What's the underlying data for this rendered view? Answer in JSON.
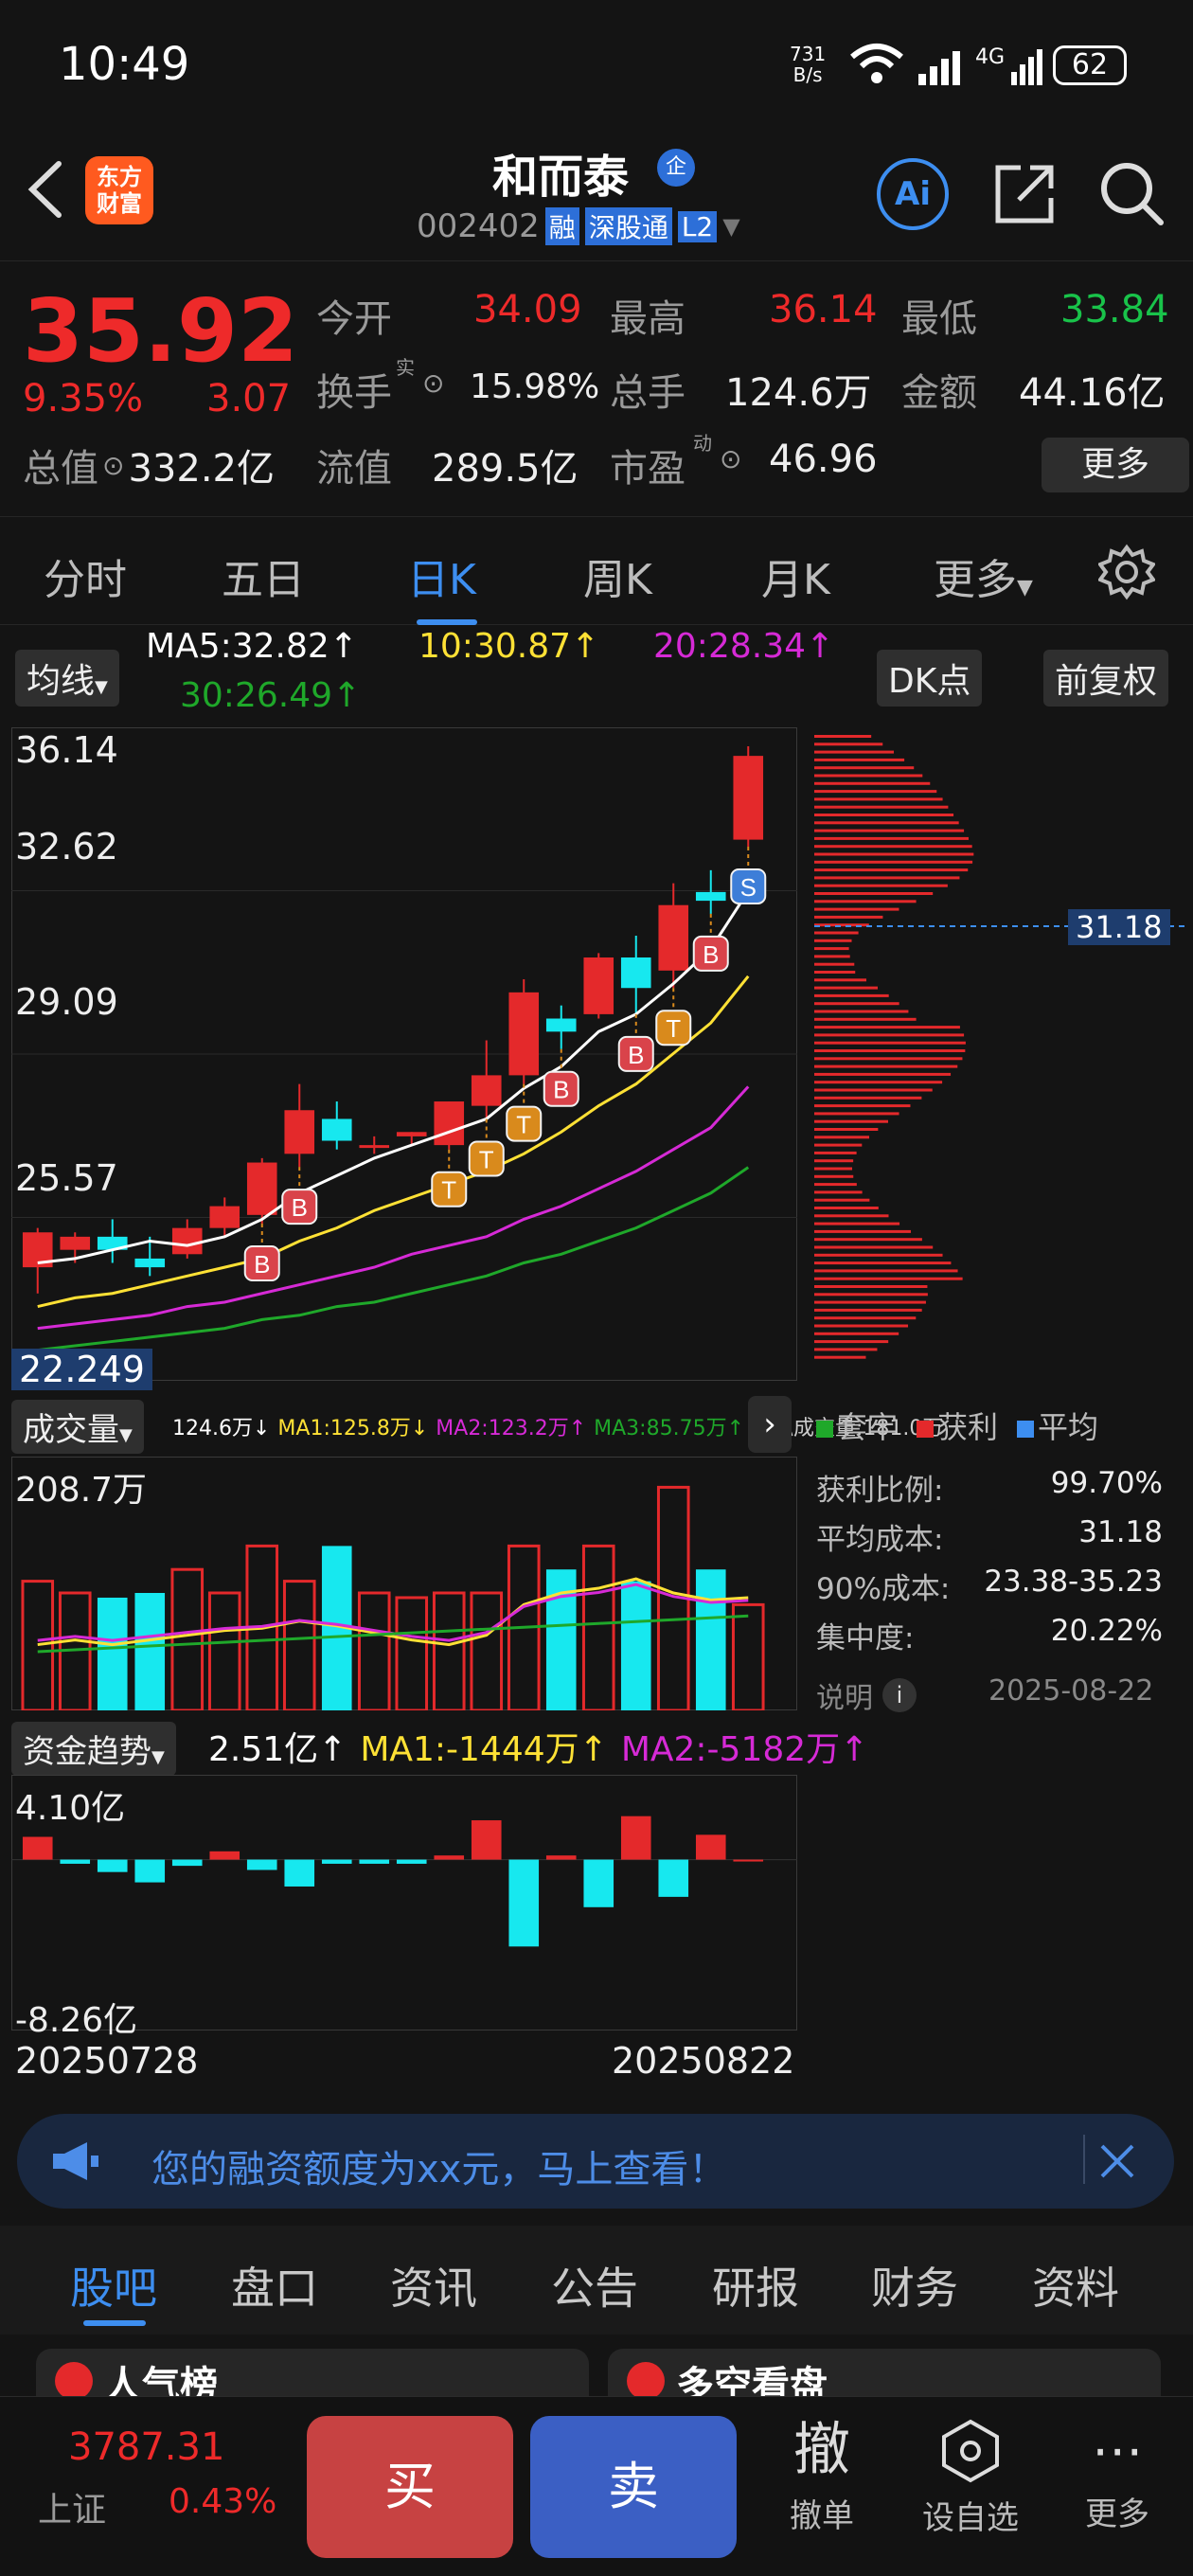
{
  "status": {
    "time": "10:49",
    "net_speed_top": "731",
    "net_speed_bottom": "B/s",
    "signal": "4G",
    "battery": "62"
  },
  "header": {
    "app_logo_line1": "东方",
    "app_logo_line2": "财富",
    "stock_name": "和而泰",
    "name_badge": "企",
    "code": "002402",
    "tag_margin": "融",
    "tag_connect": "深股通",
    "tag_level": "L2",
    "ai_label": "Ai"
  },
  "quote": {
    "price": "35.92",
    "change_pct": "9.35%",
    "change": "3.07",
    "open_label": "今开",
    "open": "34.09",
    "high_label": "最高",
    "high": "36.14",
    "low_label": "最低",
    "low": "33.84",
    "turnover_label": "换手",
    "turnover_sup": "实",
    "turnover": "15.98%",
    "volume_label": "总手",
    "volume": "124.6万",
    "amount_label": "金额",
    "amount": "44.16亿",
    "mktcap_label": "总值",
    "mktcap": "332.2亿",
    "float_label": "流值",
    "float": "289.5亿",
    "pe_label": "市盈",
    "pe_sup": "动",
    "pe": "46.96",
    "more": "更多"
  },
  "tabs": [
    "分时",
    "五日",
    "日K",
    "周K",
    "月K",
    "更多"
  ],
  "kline": {
    "ma_button": "均线",
    "ma5": "MA5:32.82↑",
    "ma10": "10:30.87↑",
    "ma20": "20:28.34↑",
    "ma30": "30:26.49↑",
    "dk_button": "DK点",
    "adjust_button": "前复权",
    "y_labels": [
      "36.14",
      "32.62",
      "29.09",
      "25.57"
    ],
    "low_label": "22.249",
    "profile_price": "31.18",
    "colors": {
      "up": "#e4292b",
      "down": "#17e8ef",
      "ma5": "#ffffff",
      "ma10": "#ffe135",
      "ma20": "#d62ad6",
      "ma30": "#1fa82a"
    }
  },
  "chart_data": {
    "type": "candlestick",
    "x_start": "20250728",
    "x_end": "20250822",
    "ylim": [
      22.249,
      36.14
    ],
    "candles": [
      {
        "o": 24.2,
        "h": 25.1,
        "l": 23.6,
        "c": 25.0
      },
      {
        "o": 24.6,
        "h": 25.0,
        "l": 24.3,
        "c": 24.9
      },
      {
        "o": 24.9,
        "h": 25.3,
        "l": 24.3,
        "c": 24.6
      },
      {
        "o": 24.4,
        "h": 24.9,
        "l": 24.0,
        "c": 24.2
      },
      {
        "o": 24.5,
        "h": 25.3,
        "l": 24.4,
        "c": 25.1
      },
      {
        "o": 25.1,
        "h": 25.8,
        "l": 24.9,
        "c": 25.6
      },
      {
        "o": 25.4,
        "h": 26.7,
        "l": 25.2,
        "c": 26.6
      },
      {
        "o": 26.8,
        "h": 28.4,
        "l": 26.5,
        "c": 27.8
      },
      {
        "o": 27.6,
        "h": 28.0,
        "l": 26.9,
        "c": 27.1
      },
      {
        "o": 27.0,
        "h": 27.2,
        "l": 26.8,
        "c": 27.0
      },
      {
        "o": 27.2,
        "h": 27.3,
        "l": 27.0,
        "c": 27.3
      },
      {
        "o": 27.0,
        "h": 28.0,
        "l": 26.9,
        "c": 28.0
      },
      {
        "o": 27.9,
        "h": 29.4,
        "l": 27.6,
        "c": 28.6
      },
      {
        "o": 28.6,
        "h": 30.8,
        "l": 28.4,
        "c": 30.5
      },
      {
        "o": 29.9,
        "h": 30.2,
        "l": 29.2,
        "c": 29.6
      },
      {
        "o": 30.0,
        "h": 31.4,
        "l": 29.9,
        "c": 31.3
      },
      {
        "o": 31.3,
        "h": 31.8,
        "l": 30.0,
        "c": 30.6
      },
      {
        "o": 31.0,
        "h": 33.0,
        "l": 30.6,
        "c": 32.5
      },
      {
        "o": 32.8,
        "h": 33.3,
        "l": 32.3,
        "c": 32.6
      },
      {
        "o": 34.0,
        "h": 36.14,
        "l": 33.84,
        "c": 35.92
      }
    ],
    "ma5": [
      24.3,
      24.4,
      24.6,
      24.8,
      24.7,
      24.9,
      25.3,
      25.9,
      26.3,
      26.7,
      27.0,
      27.3,
      27.6,
      28.3,
      28.8,
      29.6,
      30.0,
      30.7,
      31.5,
      32.82
    ],
    "ma10": [
      23.3,
      23.5,
      23.6,
      23.8,
      24.0,
      24.2,
      24.4,
      24.8,
      25.1,
      25.5,
      25.8,
      26.1,
      26.4,
      26.8,
      27.3,
      27.9,
      28.4,
      29.1,
      29.8,
      30.87
    ],
    "ma20": [
      22.8,
      22.9,
      23.0,
      23.1,
      23.3,
      23.4,
      23.6,
      23.8,
      24.0,
      24.2,
      24.5,
      24.7,
      24.9,
      25.3,
      25.6,
      26.0,
      26.4,
      26.9,
      27.4,
      28.34
    ],
    "ma30": [
      22.3,
      22.4,
      22.5,
      22.6,
      22.7,
      22.8,
      23.0,
      23.1,
      23.3,
      23.4,
      23.6,
      23.8,
      24.0,
      24.3,
      24.5,
      24.8,
      25.1,
      25.5,
      25.9,
      26.49
    ],
    "signals": [
      {
        "i": 6,
        "label": "B",
        "below": true
      },
      {
        "i": 7,
        "label": "B",
        "below": true
      },
      {
        "i": 11,
        "label": "T",
        "below": true
      },
      {
        "i": 12,
        "label": "T",
        "below": true
      },
      {
        "i": 13,
        "label": "T",
        "below": true
      },
      {
        "i": 14,
        "label": "B",
        "below": true
      },
      {
        "i": 16,
        "label": "B",
        "below": true
      },
      {
        "i": 17,
        "label": "T",
        "below": true
      },
      {
        "i": 18,
        "label": "B",
        "below": true
      },
      {
        "i": 19,
        "label": "S",
        "below": true
      }
    ],
    "volume": {
      "max": 208.7,
      "values": [
        55,
        50,
        48,
        50,
        60,
        50,
        70,
        55,
        70,
        50,
        48,
        50,
        50,
        70,
        60,
        70,
        55,
        95,
        60,
        45
      ],
      "up_down": "high",
      "ma1": [
        28,
        30,
        28,
        30,
        32,
        34,
        35,
        38,
        36,
        33,
        30,
        28,
        32,
        45,
        50,
        52,
        56,
        50,
        47,
        48
      ]
    },
    "fund_flow": {
      "top": 4.1,
      "bottom": -8.26,
      "values": [
        1.1,
        -0.2,
        -0.6,
        -1.1,
        -0.3,
        0.4,
        -0.5,
        -1.3,
        -0.2,
        -0.2,
        -0.2,
        0.2,
        1.9,
        -4.2,
        0.2,
        -2.3,
        2.1,
        -1.8,
        1.2,
        0
      ]
    }
  },
  "volume_panel": {
    "title": "成交量",
    "v": "124.6万↓",
    "ma1": "MA1:125.8万↓",
    "ma2": "MA2:123.2万↑",
    "ma3": "MA3:85.75万↑",
    "virtual": "虚拟成交量:181.0万",
    "max_label": "208.7万"
  },
  "fund_panel": {
    "title": "资金趋势",
    "v": "2.51亿↑",
    "ma1": "MA1:-1444万↑",
    "ma2": "MA2:-5182万↑",
    "top_label": "4.10亿",
    "bottom_label": "-8.26亿",
    "date_start": "20250728",
    "date_end": "20250822"
  },
  "profile": {
    "legend": [
      "套牢",
      "获利",
      "平均"
    ],
    "stats": [
      {
        "k": "获利比例:",
        "v": "99.70%"
      },
      {
        "k": "平均成本:",
        "v": "31.18"
      },
      {
        "k": "90%成本:",
        "v": "23.38-35.23"
      },
      {
        "k": "集中度:",
        "v": "20.22%"
      }
    ],
    "note_label": "说明",
    "date": "2025-08-22"
  },
  "banner": {
    "text": "您的融资额度为xx元，马上查看！"
  },
  "bottom_tabs": [
    "股吧",
    "盘口",
    "资讯",
    "公告",
    "研报",
    "财务",
    "资料"
  ],
  "peek": {
    "left": "人气榜",
    "right": "多空看盘"
  },
  "bottom_bar": {
    "index_value": "3787.31",
    "index_name": "上证",
    "index_change": "0.43%",
    "buy": "买",
    "sell": "卖",
    "cancel_icon": "撤",
    "cancel": "撤单",
    "watch": "设自选",
    "more": "更多"
  }
}
